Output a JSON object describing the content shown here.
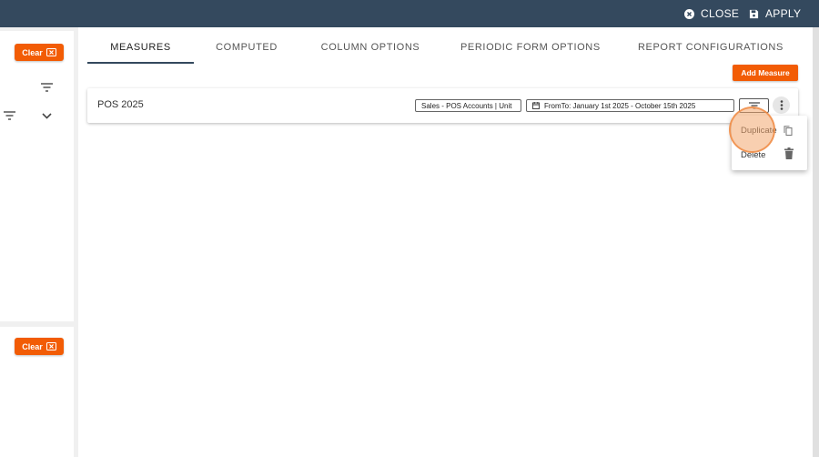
{
  "topbar": {
    "close_label": "CLOSE",
    "apply_label": "APPLY"
  },
  "left": {
    "clear_label": "Clear"
  },
  "tabs": [
    {
      "label": "MEASURES",
      "active": true
    },
    {
      "label": "COMPUTED",
      "active": false
    },
    {
      "label": "COLUMN OPTIONS",
      "active": false
    },
    {
      "label": "PERIODIC FORM OPTIONS",
      "active": false
    },
    {
      "label": "REPORT CONFIGURATIONS",
      "active": false
    }
  ],
  "add_measure_label": "Add Measure",
  "measure": {
    "name": "POS 2025",
    "source_chip": "Sales - POS Accounts | Unit",
    "date_chip": "FromTo: January 1st 2025 - October 15th 2025"
  },
  "menu": {
    "duplicate_label": "Duplicate",
    "delete_label": "Delete"
  },
  "icons": {
    "close": "close-circle-icon",
    "apply": "save-icon",
    "clear": "clear-x-icon",
    "filter": "filter-icon",
    "chevron": "chevron-down-icon",
    "calendar": "calendar-icon",
    "more": "more-vert-icon",
    "copy": "copy-icon",
    "delete": "trash-icon"
  },
  "colors": {
    "topbar": "#34495e",
    "accent": "#f25c05",
    "highlight": "#f3a870"
  }
}
